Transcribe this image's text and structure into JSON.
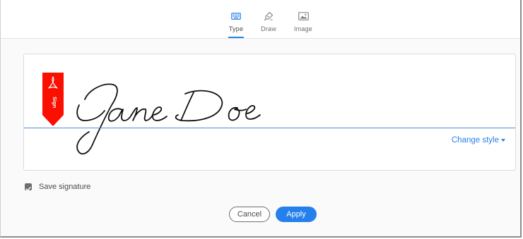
{
  "tabs": [
    {
      "label": "Type",
      "icon": "keyboard-icon",
      "active": true
    },
    {
      "label": "Draw",
      "icon": "pen-icon",
      "active": false
    },
    {
      "label": "Image",
      "icon": "image-icon",
      "active": false
    }
  ],
  "signature": {
    "text": "Jane Doe",
    "sign_flag_text": "Sign",
    "change_style_label": "Change style"
  },
  "save_signature": {
    "label": "Save signature",
    "checked": true
  },
  "buttons": {
    "cancel_label": "Cancel",
    "apply_label": "Apply"
  },
  "colors": {
    "accent": "#2680eb",
    "sign_flag": "#fa0f00",
    "signature_ink": "#111111"
  }
}
